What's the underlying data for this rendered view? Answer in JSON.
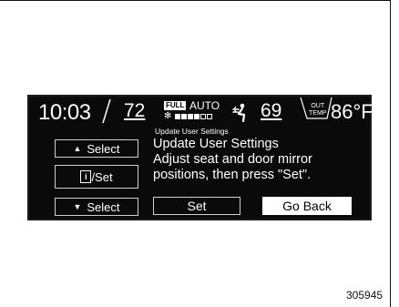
{
  "status_bar": {
    "time": "10:03",
    "driver_temp": "72",
    "fan_mode_badge": "FULL",
    "fan_mode": "AUTO",
    "fan_level": 4,
    "fan_level_max": 6,
    "passenger_temp": "69",
    "out_label_line1": "OUT",
    "out_label_line2": "TEMP",
    "outside_temp": "86°F"
  },
  "screen": {
    "subtitle": "Update User Settings",
    "message_title": "Update User Settings",
    "message_line1": "Adjust seat and door mirror",
    "message_line2": "positions, then press \"Set\"."
  },
  "buttons": {
    "select_up": "Select",
    "info_set": "/Set",
    "info_icon_text": "i",
    "select_down": "Select",
    "set": "Set",
    "go_back": "Go Back"
  },
  "figure_id": "305945",
  "icons": [
    "up-triangle-icon",
    "down-triangle-icon",
    "info-icon",
    "fan-icon",
    "airflow-icon"
  ]
}
